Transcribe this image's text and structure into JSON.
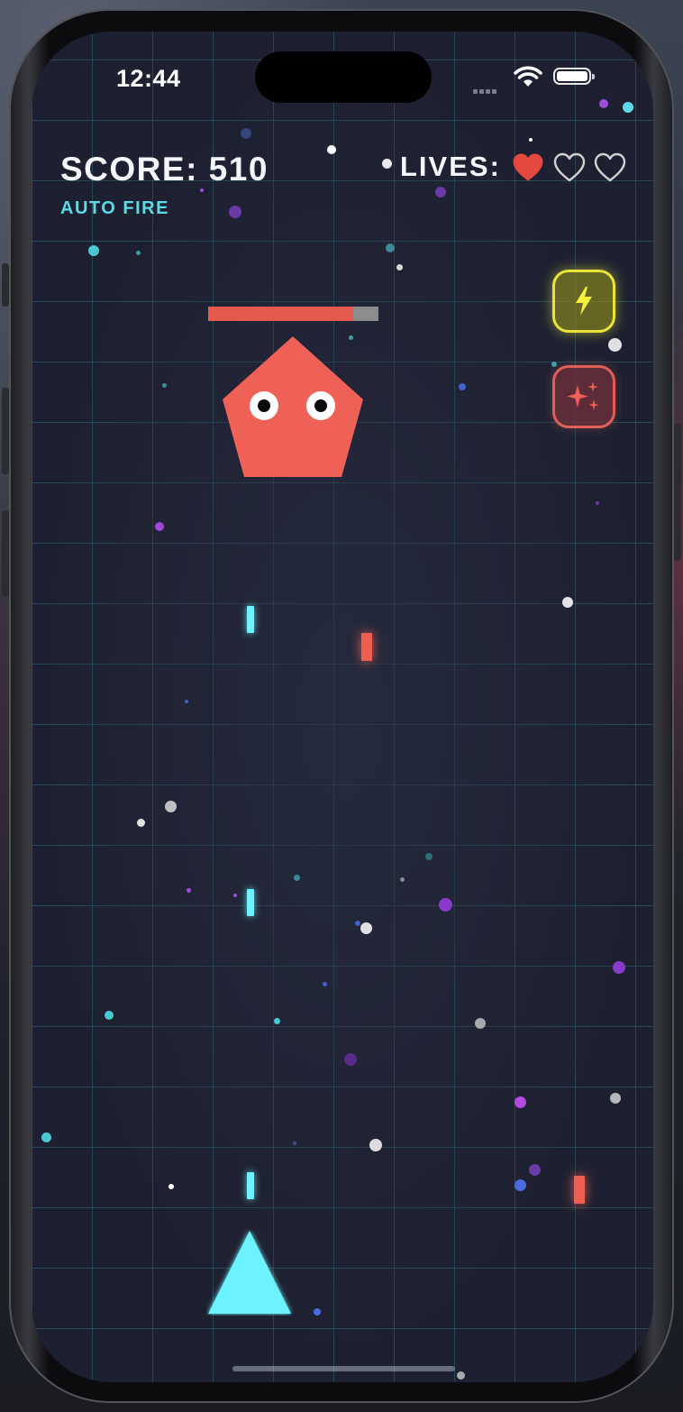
{
  "status_bar": {
    "time": "12:44"
  },
  "hud": {
    "score_text": "SCORE: 510",
    "mode_text": "AUTO FIRE",
    "lives_label": "LIVES:",
    "lives_total": 3,
    "lives_remaining": 1
  },
  "powerups": [
    {
      "name": "lightning",
      "icon": "lightning-icon",
      "color": "#e8e43c"
    },
    {
      "name": "sparkle",
      "icon": "sparkle-icon",
      "color": "#e06058"
    }
  ],
  "enemy": {
    "shape": "pentagon",
    "color": "#ef6056",
    "health_fraction": 0.85
  },
  "player": {
    "shape": "triangle",
    "color": "#6cf3ff"
  },
  "colors": {
    "background": "#1d2030",
    "grid": "#4096a0",
    "score_text": "#f4f6fb",
    "mode_text": "#5fd9e6",
    "heart_full": "#e4483e",
    "heart_empty": "#d0d0d0",
    "health_bar_bg": "#8d8d8f",
    "health_bar_fill": "#e45a4e",
    "player_bullet": "#6cf3ff",
    "enemy_bullet": "#ee5f52"
  }
}
